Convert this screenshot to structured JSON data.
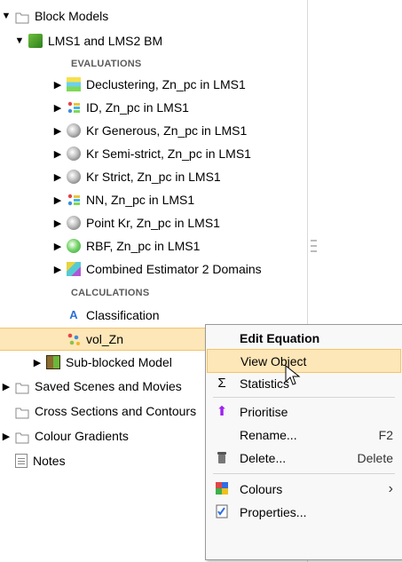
{
  "tree": {
    "block_models": "Block Models",
    "bm": "LMS1 and LMS2 BM",
    "evaluations_header": "EVALUATIONS",
    "evaluations": [
      {
        "label": "Declustering, Zn_pc in LMS1",
        "icon": "declustering-icon"
      },
      {
        "label": "ID, Zn_pc in LMS1",
        "icon": "idw-icon"
      },
      {
        "label": "Kr Generous, Zn_pc in LMS1",
        "icon": "kriging-icon"
      },
      {
        "label": "Kr Semi-strict, Zn_pc in LMS1",
        "icon": "kriging-icon"
      },
      {
        "label": "Kr Strict, Zn_pc in LMS1",
        "icon": "kriging-icon"
      },
      {
        "label": "NN, Zn_pc in LMS1",
        "icon": "nearest-neighbour-icon"
      },
      {
        "label": "Point Kr, Zn_pc in LMS1",
        "icon": "kriging-icon"
      },
      {
        "label": "RBF, Zn_pc in LMS1",
        "icon": "rbf-icon"
      },
      {
        "label": "Combined Estimator 2 Domains",
        "icon": "combined-estimator-icon"
      }
    ],
    "calculations_header": "CALCULATIONS",
    "classification": "Classification",
    "vol_zn": "vol_Zn",
    "sub_blocked": "Sub-blocked Model",
    "saved_scenes": "Saved Scenes and Movies",
    "cross_sections": "Cross Sections and Contours",
    "colour_gradients": "Colour Gradients",
    "notes": "Notes"
  },
  "menu": {
    "edit_equation": "Edit Equation",
    "view_object": "View Object",
    "statistics": "Statistics",
    "prioritise": "Prioritise",
    "rename": "Rename...",
    "rename_shortcut": "F2",
    "delete": "Delete...",
    "delete_shortcut": "Delete",
    "colours": "Colours",
    "properties": "Properties..."
  },
  "colors": {
    "selection": "#fde6b7",
    "selection_border": "#f3c46c",
    "accent_purple": "#a020f0"
  }
}
